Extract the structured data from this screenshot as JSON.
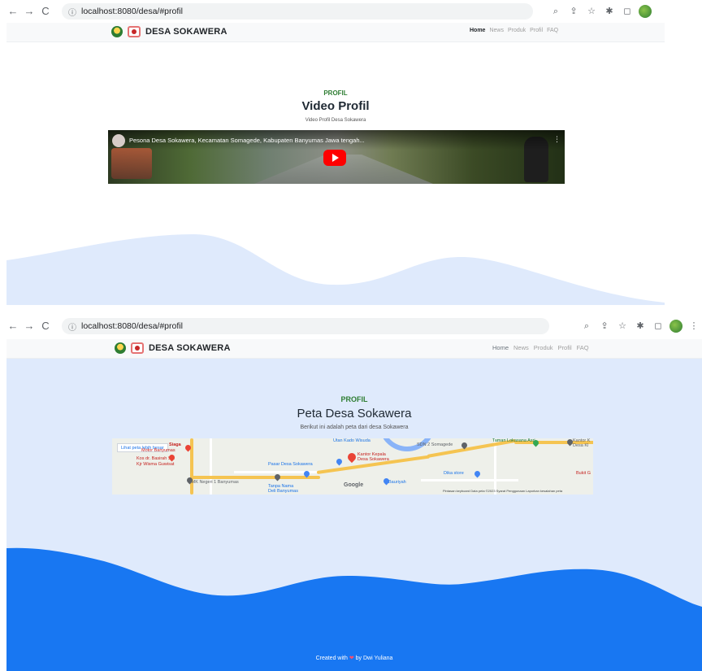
{
  "browser": {
    "url": "localhost:8080/desa/#profil",
    "nav": {
      "back": "←",
      "forward": "→",
      "reload": "C"
    },
    "info_glyph": "ⓘ",
    "tools": [
      "zoom-icon",
      "share-icon",
      "star-icon",
      "extensions-icon",
      "sidepanel-icon"
    ],
    "tool_glyphs": {
      "zoom": "⌕",
      "share": "⇪",
      "star": "☆",
      "ext": "✱",
      "panel": "◻",
      "more": "⋮"
    }
  },
  "site": {
    "brand": "DESA SOKAWERA",
    "menu": {
      "home": "Home",
      "news": "News",
      "produk": "Produk",
      "profil": "Profil",
      "faq": "FAQ"
    }
  },
  "video_section": {
    "label": "PROFIL",
    "title": "Video Profil",
    "subtitle": "Video Profil Desa Sokawera",
    "video_title": "Pesona Desa Sokawera, Kecamatan Somagede, Kabupaten Banyumas Jawa tengah...",
    "more": "⋮"
  },
  "map_section": {
    "label": "PROFIL",
    "title": "Peta Desa Sokawera",
    "subtitle": "Berikut ini adalah peta dari desa Sokawera",
    "map": {
      "view_larger": "Lihat peta lebih besar",
      "labels": {
        "siaga": "Siaga",
        "motor": "Motor Banyumas",
        "kos": "Kos dr. Basirah Sp.",
        "kos2": "Kjr Wisma Guwisat",
        "pasar": "Pasar Desa Sokawera",
        "kantor": "Kantor Kepala",
        "kantor2": "Desa Sokawera",
        "sdn": "SDN 2 Somagede",
        "taman": "Taman Lokasana Asri",
        "kantor_k": "Kantor K",
        "desa_kl": "Desa Kl",
        "dika": "Dika store",
        "smk": "SMK Negeri 1 Banyumas",
        "tanpa": "Tanpa Nama",
        "deli": "Deli Banyumas",
        "bauriyah": "Bauriyah",
        "bukit": "Bukit G",
        "utan": "Utan Kado Wisuda",
        "road": "Jl. Baturaden"
      },
      "google": "Google",
      "footer": "Pintasan keyboard   Data peta ©2023   Syarat Penggunaan   Laporkan kesalahan peta"
    }
  },
  "footer": {
    "before": "Created with",
    "heart": "❤",
    "after": "by Dwi Yuliana"
  },
  "colors": {
    "accent_green": "#2e7d32",
    "wave_light": "#dfeafc",
    "wave_blue": "#1877f2",
    "youtube_red": "#ff0000"
  }
}
